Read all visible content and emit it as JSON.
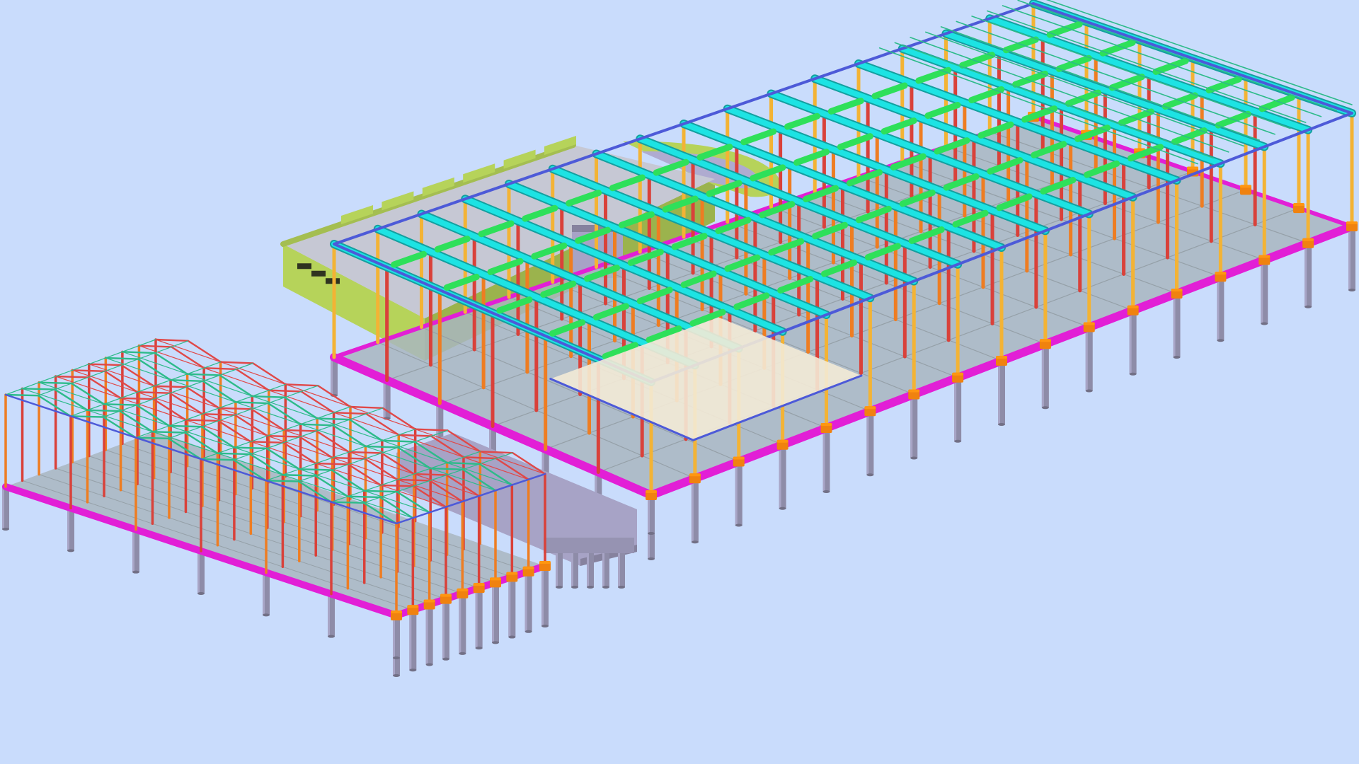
{
  "scene": {
    "type": "3d-structural-model",
    "view": "isometric",
    "colors": {
      "background": "#c9dcfc",
      "pile": "#8e8ca8",
      "pile_cap": "#f0820f",
      "ground_beam": "#e21fd6",
      "slab": "#a9b6bf",
      "column_red": "#d9413a",
      "column_orange": "#ee7d22",
      "column_yellow": "#f3b335",
      "roof_beam": "#1de3e3",
      "purlin": "#2ee05a",
      "edge_beam": "#4d5ad8",
      "truss_green": "#2dbb8a",
      "truss_red": "#e04848",
      "existing_roof": "#c6c8d4",
      "parapet": "#b6d35a",
      "podium": "#a7a3c6",
      "platform": "#f3ead6"
    },
    "main_hall": {
      "bays": 16,
      "spans": 6
    },
    "annex": {
      "bays": 9,
      "spans": 6
    },
    "existing_building": {
      "windows": 3,
      "parapet_bumps": 6
    }
  }
}
